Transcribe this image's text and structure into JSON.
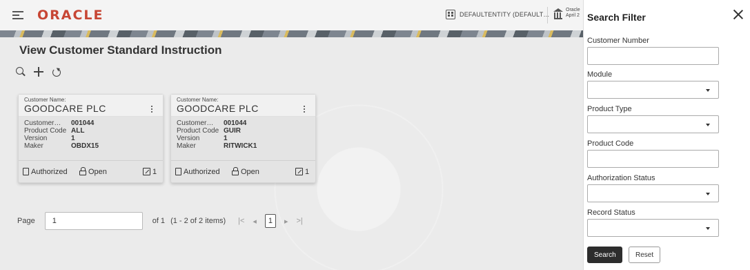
{
  "header": {
    "logo": "ORACLE",
    "entity": "DEFAULTENTITY (DEFAULT…",
    "bank_line1": "Oracle",
    "bank_line2": "April 2"
  },
  "main": {
    "title": "View Customer Standard Instruction"
  },
  "cards": [
    {
      "customer_label": "Customer Name:",
      "customer_name": "GOODCARE PLC",
      "fields": [
        {
          "k": "Customer…",
          "v": "001044"
        },
        {
          "k": "Product Code",
          "v": "ALL"
        },
        {
          "k": "Version",
          "v": "1"
        },
        {
          "k": "Maker",
          "v": "OBDX15"
        }
      ],
      "status": "Authorized",
      "record": "Open",
      "edits": "1"
    },
    {
      "customer_label": "Customer Name:",
      "customer_name": "GOODCARE PLC",
      "fields": [
        {
          "k": "Customer…",
          "v": "001044"
        },
        {
          "k": "Product Code",
          "v": "GUIR"
        },
        {
          "k": "Version",
          "v": "1"
        },
        {
          "k": "Maker",
          "v": "RITWICK1"
        }
      ],
      "status": "Authorized",
      "record": "Open",
      "edits": "1"
    }
  ],
  "pager": {
    "label": "Page",
    "value": "1",
    "of": "of 1",
    "range": "(1 - 2 of 2 items)",
    "first": "|<",
    "prev": "◂",
    "current": "1",
    "next": "▸",
    "last": ">|"
  },
  "filter": {
    "title": "Search Filter",
    "fields": [
      {
        "label": "Customer Number",
        "value": ""
      },
      {
        "label": "Module",
        "value": ""
      },
      {
        "label": "Product Type",
        "value": ""
      },
      {
        "label": "Product Code",
        "value": ""
      },
      {
        "label": "Authorization Status",
        "value": ""
      },
      {
        "label": "Record Status",
        "value": ""
      }
    ],
    "search_label": "Search",
    "reset_label": "Reset"
  },
  "colors": {
    "brand": "#c74634",
    "primary_button": "#2d2d2d"
  }
}
